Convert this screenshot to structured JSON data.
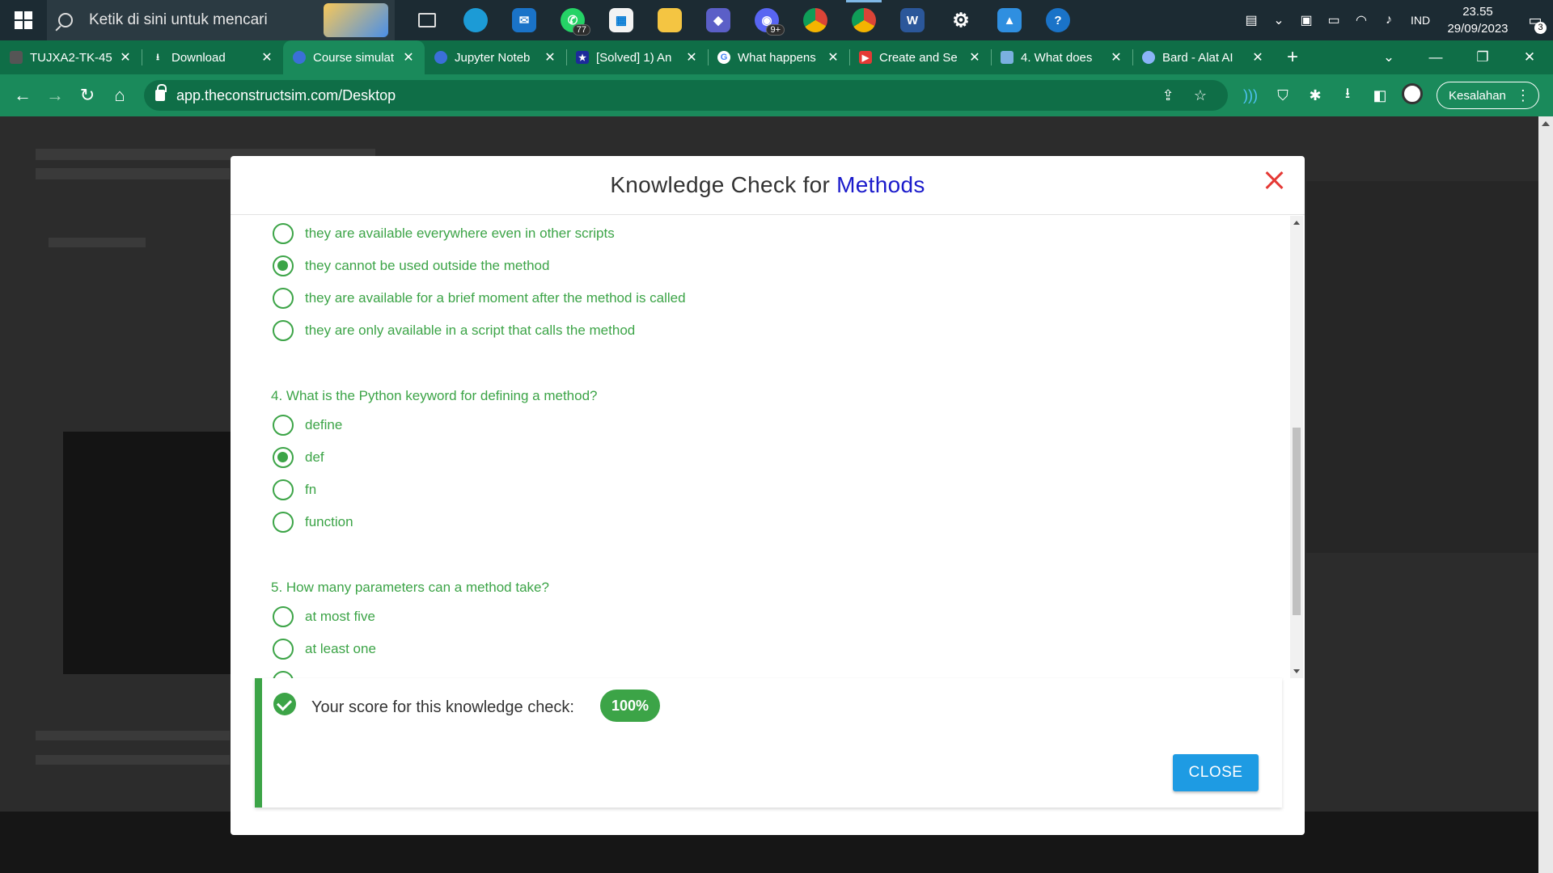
{
  "taskbar": {
    "search_placeholder": "Ketik di sini untuk mencari",
    "whatsapp_badge": "77",
    "discord_badge": "9+",
    "language": "IND",
    "time": "23.55",
    "date": "29/09/2023",
    "notification_count": "3"
  },
  "tabs": [
    {
      "title": "TUJXA2-TK-45",
      "fav_color": "#555555"
    },
    {
      "title": "Download",
      "fav_color": "#0f6e47"
    },
    {
      "title": "Course simulat",
      "fav_color": "#3b6fd8"
    },
    {
      "title": "Jupyter Noteb",
      "fav_color": "#3b6fd8"
    },
    {
      "title": "[Solved] 1) An",
      "fav_color": "#1c2a9a"
    },
    {
      "title": "What happens",
      "fav_color": "#ffffff"
    },
    {
      "title": "Create and Se",
      "fav_color": "#e53935"
    },
    {
      "title": "4. What does",
      "fav_color": "#7ab0e0"
    },
    {
      "title": "Bard - Alat AI",
      "fav_color": "#8ab4f8"
    }
  ],
  "address_bar": {
    "url": "app.theconstructsim.com/Desktop",
    "profile_label": "Kesalahan"
  },
  "modal": {
    "title_prefix": "Knowledge Check for",
    "title_highlight": "Methods",
    "q3_options": [
      {
        "label": "they are available everywhere even in other scripts",
        "selected": false
      },
      {
        "label": "they cannot be used outside the method",
        "selected": true
      },
      {
        "label": "they are available for a brief moment after the method is called",
        "selected": false
      },
      {
        "label": "they are only available in a script that calls the method",
        "selected": false
      }
    ],
    "q4": {
      "question": "4. What is the Python keyword for defining a method?",
      "options": [
        {
          "label": "define",
          "selected": false
        },
        {
          "label": "def",
          "selected": true
        },
        {
          "label": "fn",
          "selected": false
        },
        {
          "label": "function",
          "selected": false
        }
      ]
    },
    "q5": {
      "question": "5. How many parameters can a method take?",
      "options": [
        {
          "label": "at most five",
          "selected": false
        },
        {
          "label": "at least one",
          "selected": false
        }
      ]
    },
    "score_text": "Your score for this knowledge check:",
    "score_value": "100%",
    "close_label": "CLOSE"
  },
  "colors": {
    "accent_green": "#3ca447",
    "title_blue": "#1a1acb",
    "close_red": "#e53935",
    "button_blue": "#1e9be3",
    "chrome_green": "#1a8a5b"
  }
}
